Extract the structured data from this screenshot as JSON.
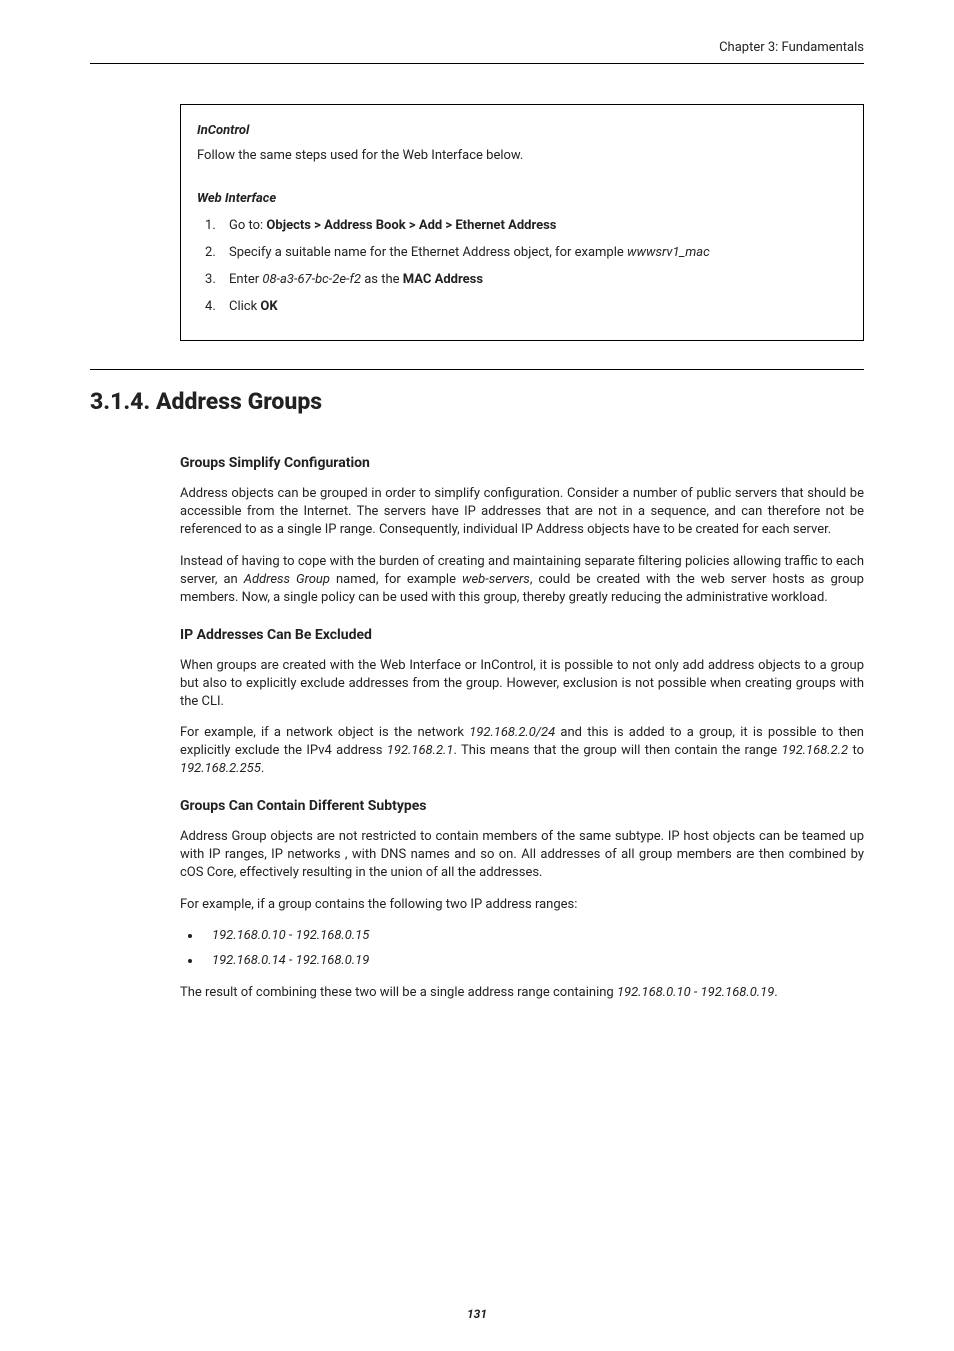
{
  "header": {
    "chapter": "Chapter 3: Fundamentals"
  },
  "box": {
    "sec1_title": "InControl",
    "sec1_text": "Follow the same steps used for the Web Interface below.",
    "sec2_title": "Web Interface",
    "steps": {
      "s1_pre": "Go to: ",
      "s1_bold": "Objects > Address Book > Add > Ethernet Address",
      "s2_pre": "Specify a suitable name for the Ethernet Address object, for example ",
      "s2_ital": "wwwsrv1_mac",
      "s3_pre": "Enter ",
      "s3_ital": "08-a3-67-bc-2e-f2",
      "s3_mid": " as the ",
      "s3_bold": "MAC Address",
      "s4_pre": "Click ",
      "s4_bold": "OK"
    }
  },
  "section": {
    "heading": "3.1.4. Address Groups",
    "groups_simplify": {
      "title": "Groups Simplify Configuration",
      "p1": "Address objects can be grouped in order to simplify configuration. Consider a number of public servers that should be accessible from the Internet. The servers have IP addresses that are not in a sequence, and can therefore not be referenced to as a single IP range. Consequently, individual IP Address objects have to be created for each server.",
      "p2_a": "Instead of having to cope with the burden of creating and maintaining separate filtering policies allowing traffic to each server, an ",
      "p2_i1": "Address Group",
      "p2_b": " named, for example ",
      "p2_i2": "web-servers",
      "p2_c": ", could be created with the web server hosts as group members. Now, a single policy can be used with this group, thereby greatly reducing the administrative workload."
    },
    "ip_excluded": {
      "title": "IP Addresses Can Be Excluded",
      "p1": "When groups are created with the Web Interface or InControl, it is possible to not only add address objects to a group but also to explicitly exclude addresses from the group. However, exclusion is not possible when creating groups with the CLI.",
      "p2_a": "For example, if a network object is the network ",
      "p2_i1": "192.168.2.0/24",
      "p2_b": " and this is added to a group, it is possible to then explicitly exclude the IPv4 address ",
      "p2_i2": "192.168.2.1",
      "p2_c": ". This means that the group will then contain the range ",
      "p2_i3": "192.168.2.2",
      "p2_d": " to ",
      "p2_i4": "192.168.2.255",
      "p2_e": "."
    },
    "subtypes": {
      "title": "Groups Can Contain Different Subtypes",
      "p1": "Address Group objects are not restricted to contain members of the same subtype. IP host objects can be teamed up with IP ranges, IP networks , with DNS names and so on. All addresses of all group members are then combined by cOS Core, effectively resulting in the union of all the addresses.",
      "p2": "For example, if a group contains the following two IP address ranges:",
      "li1": "192.168.0.10 - 192.168.0.15",
      "li2": "192.168.0.14 - 192.168.0.19",
      "p3_a": "The result of combining these two will be a single address range containing ",
      "p3_i1": "192.168.0.10 - 192.168.0.19",
      "p3_b": "."
    }
  },
  "page_number": "131"
}
